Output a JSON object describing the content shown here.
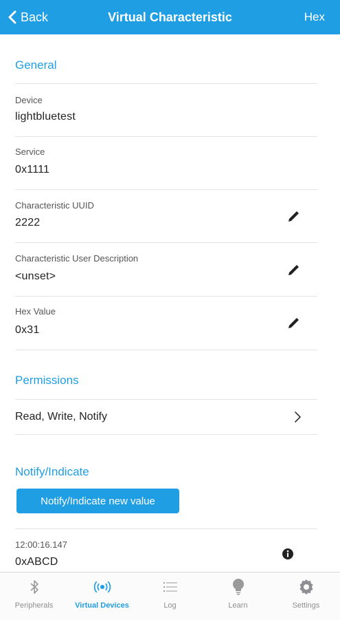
{
  "nav": {
    "back_label": "Back",
    "title": "Virtual Characteristic",
    "hex_label": "Hex"
  },
  "general": {
    "title": "General",
    "device": {
      "label": "Device",
      "value": "lightbluetest"
    },
    "service": {
      "label": "Service",
      "value": "0x1111"
    },
    "uuid": {
      "label": "Characteristic UUID",
      "value": "2222"
    },
    "description": {
      "label": "Characteristic User Description",
      "value": "<unset>"
    },
    "hex_value": {
      "label": "Hex Value",
      "value": "0x31"
    }
  },
  "permissions": {
    "title": "Permissions",
    "value": "Read, Write, Notify"
  },
  "notify": {
    "title": "Notify/Indicate",
    "button_label": "Notify/Indicate new value",
    "entry": {
      "timestamp": "12:00:16.147",
      "value": "0xABCD"
    }
  },
  "tabs": [
    {
      "label": "Peripherals",
      "icon": "bluetooth-icon"
    },
    {
      "label": "Virtual Devices",
      "icon": "broadcast-icon"
    },
    {
      "label": "Log",
      "icon": "list-icon"
    },
    {
      "label": "Learn",
      "icon": "lightbulb-icon"
    },
    {
      "label": "Settings",
      "icon": "gear-icon"
    }
  ],
  "active_tab": "Virtual Devices",
  "colors": {
    "accent": "#1f9ee3",
    "text": "#222222",
    "muted": "#8e8e93"
  }
}
